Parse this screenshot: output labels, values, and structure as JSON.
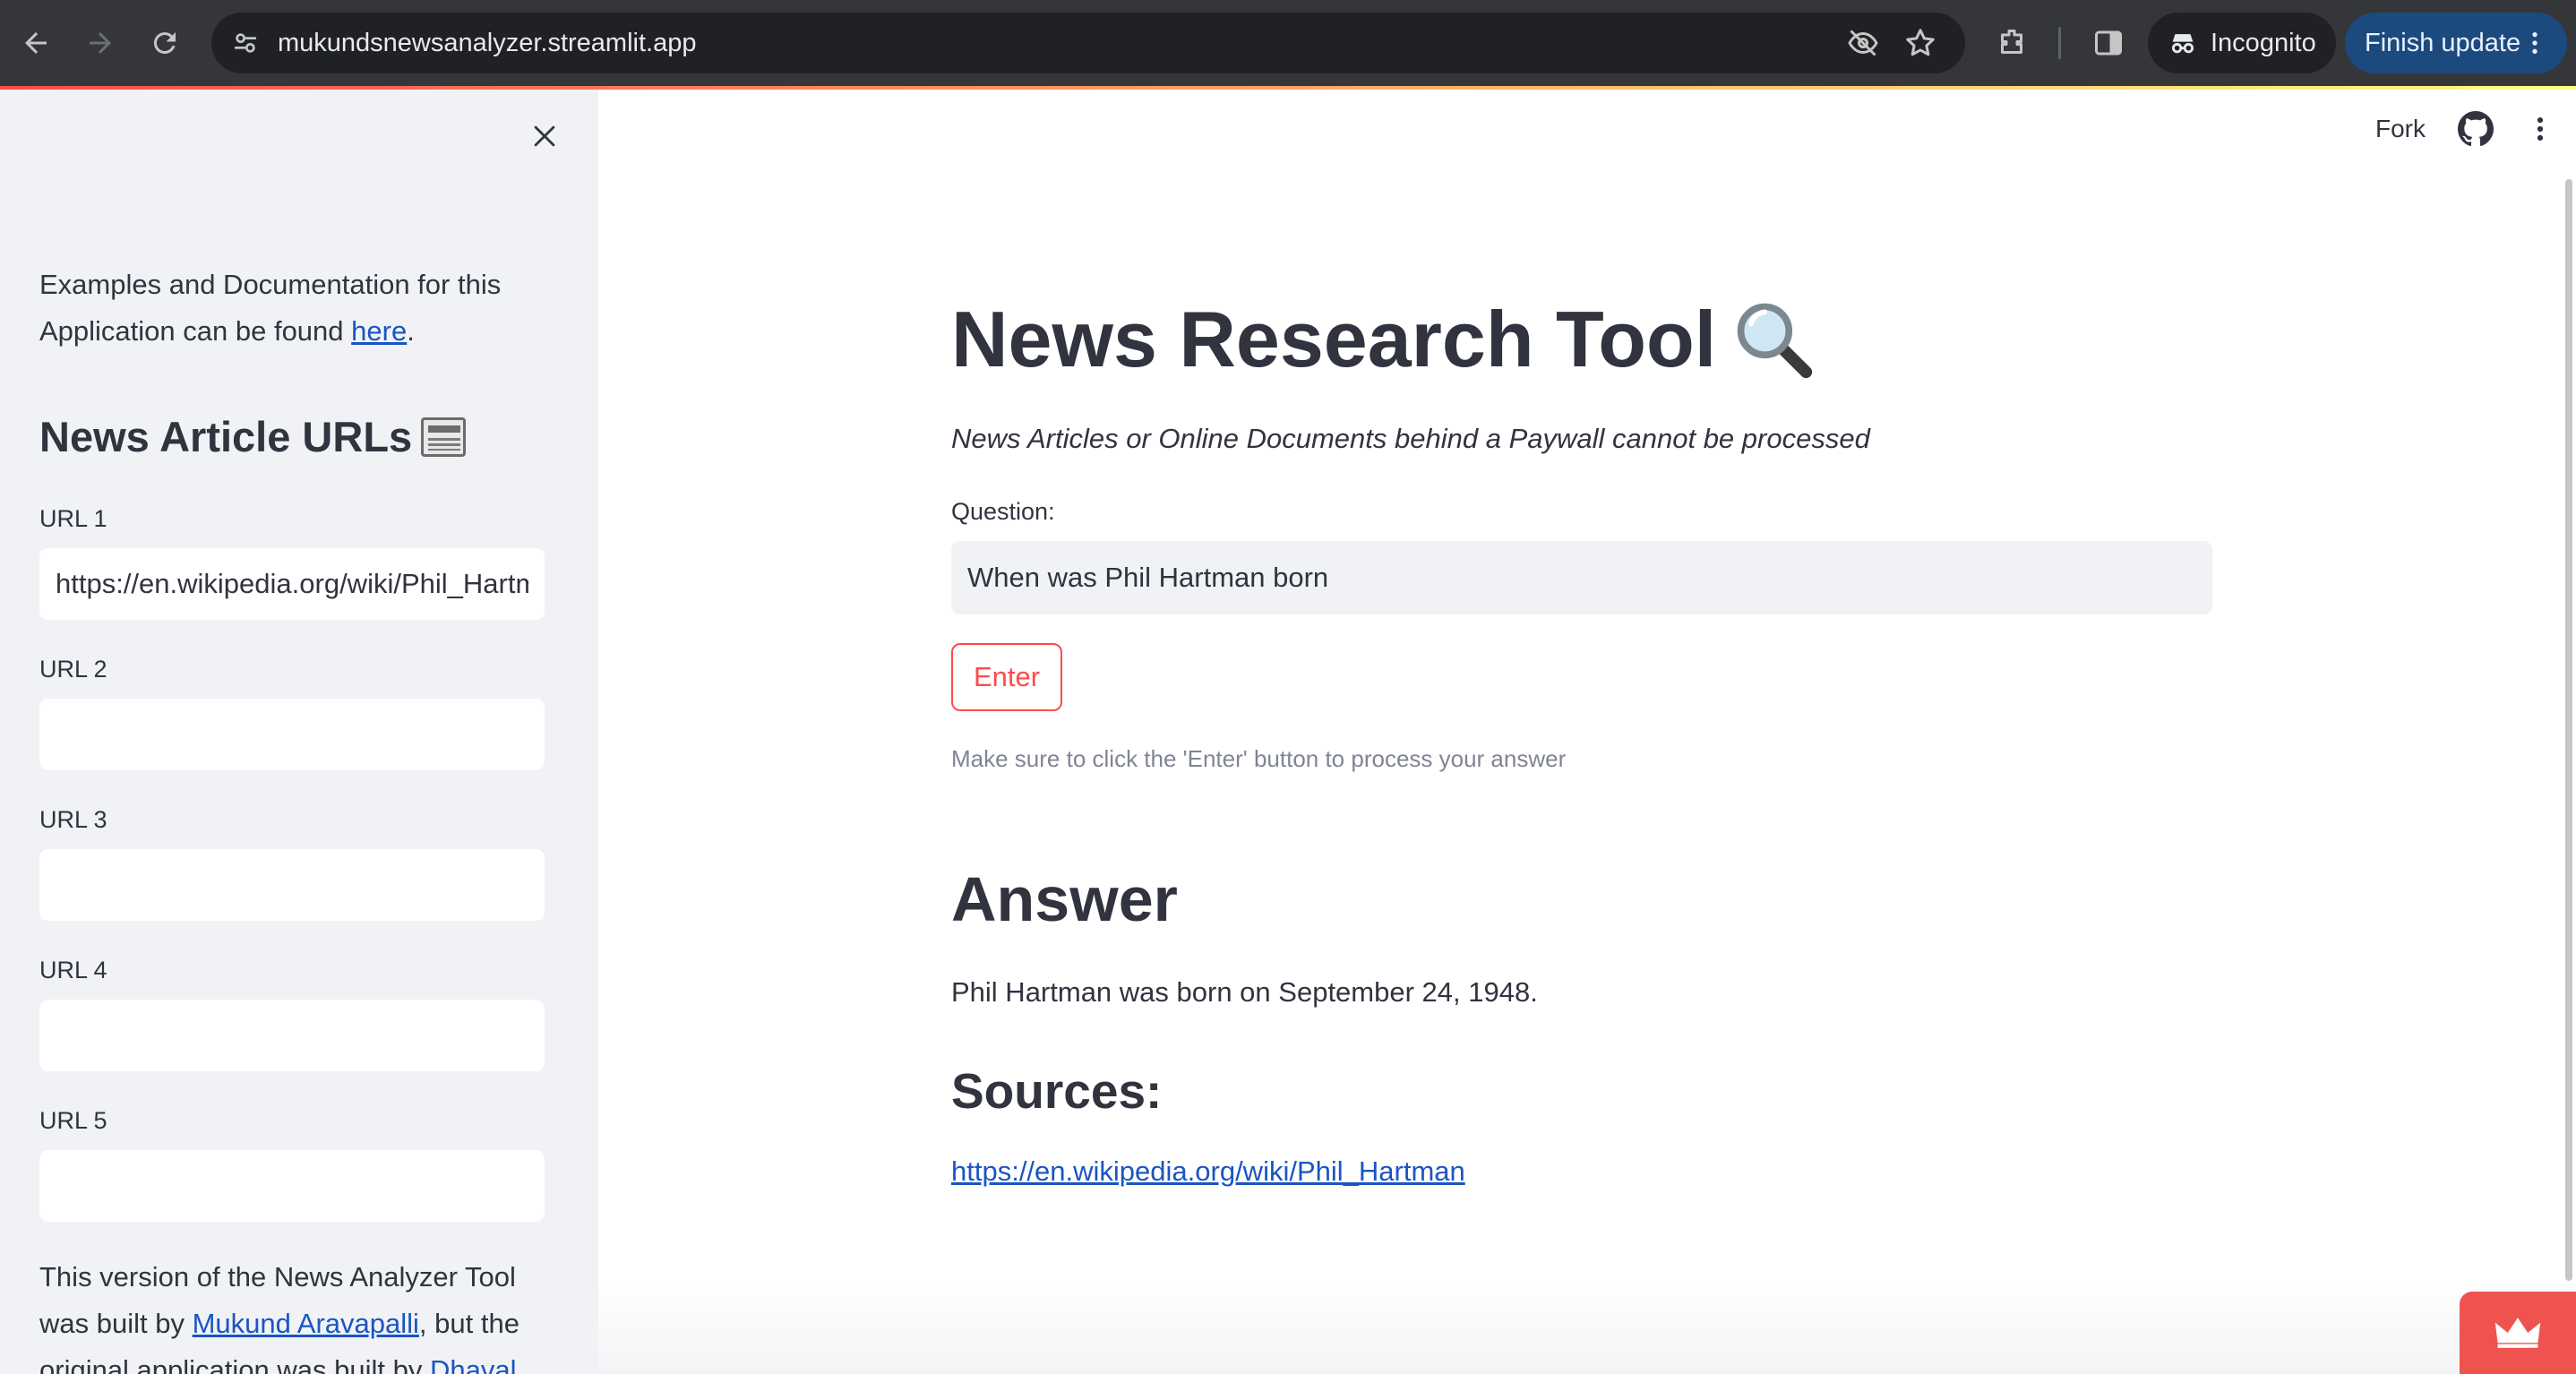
{
  "browser": {
    "url": "mukundsnewsanalyzer.streamlit.app",
    "incognito_label": "Incognito",
    "finish_update_label": "Finish update"
  },
  "sidebar": {
    "intro_text": "Examples and Documentation for this Application can be found ",
    "intro_link": "here",
    "intro_suffix": ".",
    "section_title": "News Article URLs",
    "section_icon": "newspaper-icon",
    "urls": [
      {
        "label": "URL 1",
        "value": "https://en.wikipedia.org/wiki/Phil_Hartman"
      },
      {
        "label": "URL 2",
        "value": ""
      },
      {
        "label": "URL 3",
        "value": ""
      },
      {
        "label": "URL 4",
        "value": ""
      },
      {
        "label": "URL 5",
        "value": ""
      }
    ],
    "credits_prefix": "This version of the News Analyzer Tool was built by ",
    "credits_author_link": "Mukund Aravapalli",
    "credits_middle": ", but the original application was built by ",
    "credits_original_link": "Dhaval"
  },
  "header": {
    "fork_label": "Fork"
  },
  "main": {
    "title": "News Research Tool",
    "title_icon": "magnifying-glass-icon",
    "subtitle": "News Articles or Online Documents behind a Paywall cannot be processed",
    "question_label": "Question:",
    "question_value": "When was Phil Hartman born",
    "enter_label": "Enter",
    "hint": "Make sure to click the 'Enter' button to process your answer",
    "answer_heading": "Answer",
    "answer_text": "Phil Hartman was born on September 24, 1948.",
    "sources_heading": "Sources:",
    "source_link": "https://en.wikipedia.org/wiki/Phil_Hartman"
  },
  "colors": {
    "primary": "#ff4b4b",
    "link": "#1a55c2",
    "sidebar_bg": "#f0f2f6",
    "text": "#31333f",
    "chrome_bg": "#35363a"
  }
}
